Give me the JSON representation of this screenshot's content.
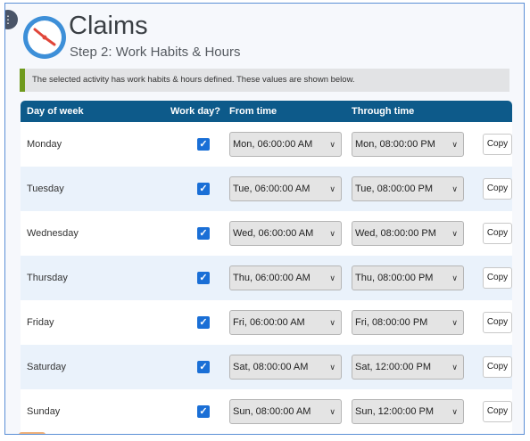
{
  "header": {
    "title": "Claims",
    "subtitle": "Step 2: Work Habits & Hours",
    "menu_icon": "ellipsis-icon",
    "logo_icon": "clock-icon"
  },
  "info_message": "The selected activity has work habits & hours defined. These values are shown below.",
  "colors": {
    "header_bg": "#0d5a8a",
    "accent": "#1a6fd6",
    "info_bar": "#6f9a1d"
  },
  "table": {
    "columns": [
      "Day of week",
      "Work day?",
      "From time",
      "Through time"
    ],
    "copy_label": "Copy",
    "rows": [
      {
        "day": "Monday",
        "work": true,
        "from": "Mon, 06:00:00 AM",
        "through": "Mon, 08:00:00 PM"
      },
      {
        "day": "Tuesday",
        "work": true,
        "from": "Tue, 06:00:00 AM",
        "through": "Tue, 08:00:00 PM"
      },
      {
        "day": "Wednesday",
        "work": true,
        "from": "Wed, 06:00:00 AM",
        "through": "Wed, 08:00:00 PM"
      },
      {
        "day": "Thursday",
        "work": true,
        "from": "Thu, 06:00:00 AM",
        "through": "Thu, 08:00:00 PM"
      },
      {
        "day": "Friday",
        "work": true,
        "from": "Fri, 06:00:00 AM",
        "through": "Fri, 08:00:00 PM"
      },
      {
        "day": "Saturday",
        "work": true,
        "from": "Sat, 08:00:00 AM",
        "through": "Sat, 12:00:00 PM"
      },
      {
        "day": "Sunday",
        "work": true,
        "from": "Sun, 08:00:00 AM",
        "through": "Sun, 12:00:00 PM"
      }
    ]
  }
}
